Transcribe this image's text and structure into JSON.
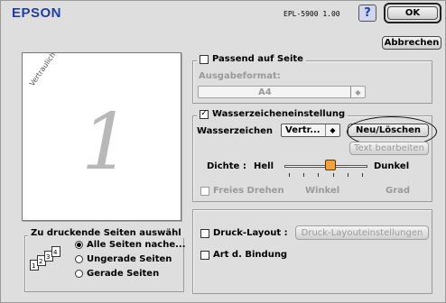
{
  "header": {
    "logo": "EPSON",
    "model": "EPL-5900 1.00",
    "help_symbol": "?",
    "ok_label": "OK",
    "cancel_label": "Abbrechen",
    "brand_color": "#1f3fa6"
  },
  "preview": {
    "watermark_text": "Vertraulich",
    "page_number": "1"
  },
  "fit_page": {
    "checkbox_label": "Passend auf Seite",
    "checked": false,
    "output_format_label": "Ausgabeformat:",
    "output_format_value": "A4"
  },
  "watermark": {
    "checkbox_label": "Wasserzeicheneinstellung",
    "checked": true,
    "check_glyph": "✓",
    "label": "Wasserzeichen",
    "value": "Vertr...",
    "new_delete_label": "Neu/Löschen",
    "edit_text_label": "Text bearbeiten",
    "density_label": "Dichte :",
    "light_label": "Hell",
    "dark_label": "Dunkel",
    "density_level": 0.55,
    "free_rotate_label": "Freies Drehen",
    "angle_label": "Winkel",
    "degree_label": "Grad"
  },
  "layout": {
    "print_layout_label": "Druck-Layout :",
    "print_layout_button": "Druck-Layouteinstellungen",
    "binding_label": "Art d. Bindung"
  },
  "pages": {
    "title": "Zu druckende Seiten auswähl",
    "options": [
      {
        "label": "Alle Seiten nache...",
        "selected": true
      },
      {
        "label": "Ungerade Seiten",
        "selected": false
      },
      {
        "label": "Gerade Seiten",
        "selected": false
      }
    ],
    "icon_numbers": [
      "1",
      "2",
      "3",
      "4"
    ]
  }
}
